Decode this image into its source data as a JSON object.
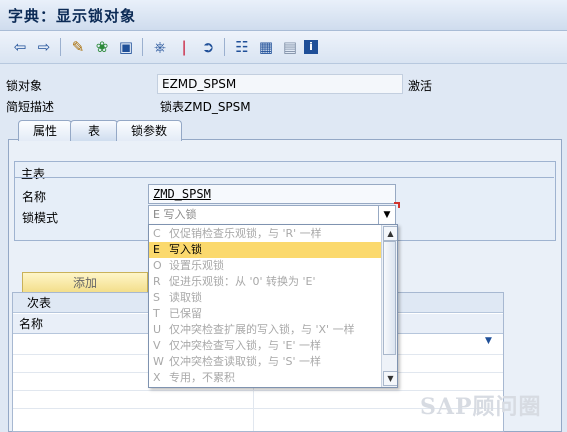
{
  "window": {
    "title": "字典：显示锁对象"
  },
  "toolbar": {
    "icons": [
      "back-icon",
      "forward-icon",
      "display-change-icon",
      "other-object-icon",
      "activate-icon",
      "where-used-icon",
      "info-icon",
      "navigate-icon",
      "hierarchy-icon",
      "print-icon",
      "layout-icon",
      "help-info-icon"
    ]
  },
  "header": {
    "lock_object_label": "锁对象",
    "lock_object_value": "EZMD_SPSM",
    "status": "激活",
    "short_desc_label": "简短描述",
    "short_desc_value": "锁表ZMD_SPSM"
  },
  "tabs": [
    {
      "label": "属性"
    },
    {
      "label": "表"
    },
    {
      "label": "锁参数"
    }
  ],
  "primary_table": {
    "group_title": "主表",
    "name_label": "名称",
    "name_value": "ZMD_SPSM",
    "lock_mode_label": "锁模式",
    "lock_mode_value": "E 写入锁"
  },
  "add_button": {
    "label": "添加"
  },
  "secondary_table": {
    "title": "次表",
    "col_name": "名称"
  },
  "dropdown": {
    "options": [
      {
        "key": "C",
        "text": "仅促销检查乐观锁，与 'R' 一样"
      },
      {
        "key": "E",
        "text": "写入锁"
      },
      {
        "key": "O",
        "text": "设置乐观锁"
      },
      {
        "key": "R",
        "text": "促进乐观锁：从 '0' 转换为 'E'"
      },
      {
        "key": "S",
        "text": "读取锁"
      },
      {
        "key": "T",
        "text": "已保留"
      },
      {
        "key": "U",
        "text": "仅冲突检查扩展的写入锁，与 'X' 一样"
      },
      {
        "key": "V",
        "text": "仅冲突检查写入锁，与 'E' 一样"
      },
      {
        "key": "W",
        "text": "仅冲突检查读取锁，与 'S' 一样"
      },
      {
        "key": "X",
        "text": "专用，不累积"
      }
    ],
    "selected_index": 1
  },
  "watermark": "SAP顾问圈"
}
